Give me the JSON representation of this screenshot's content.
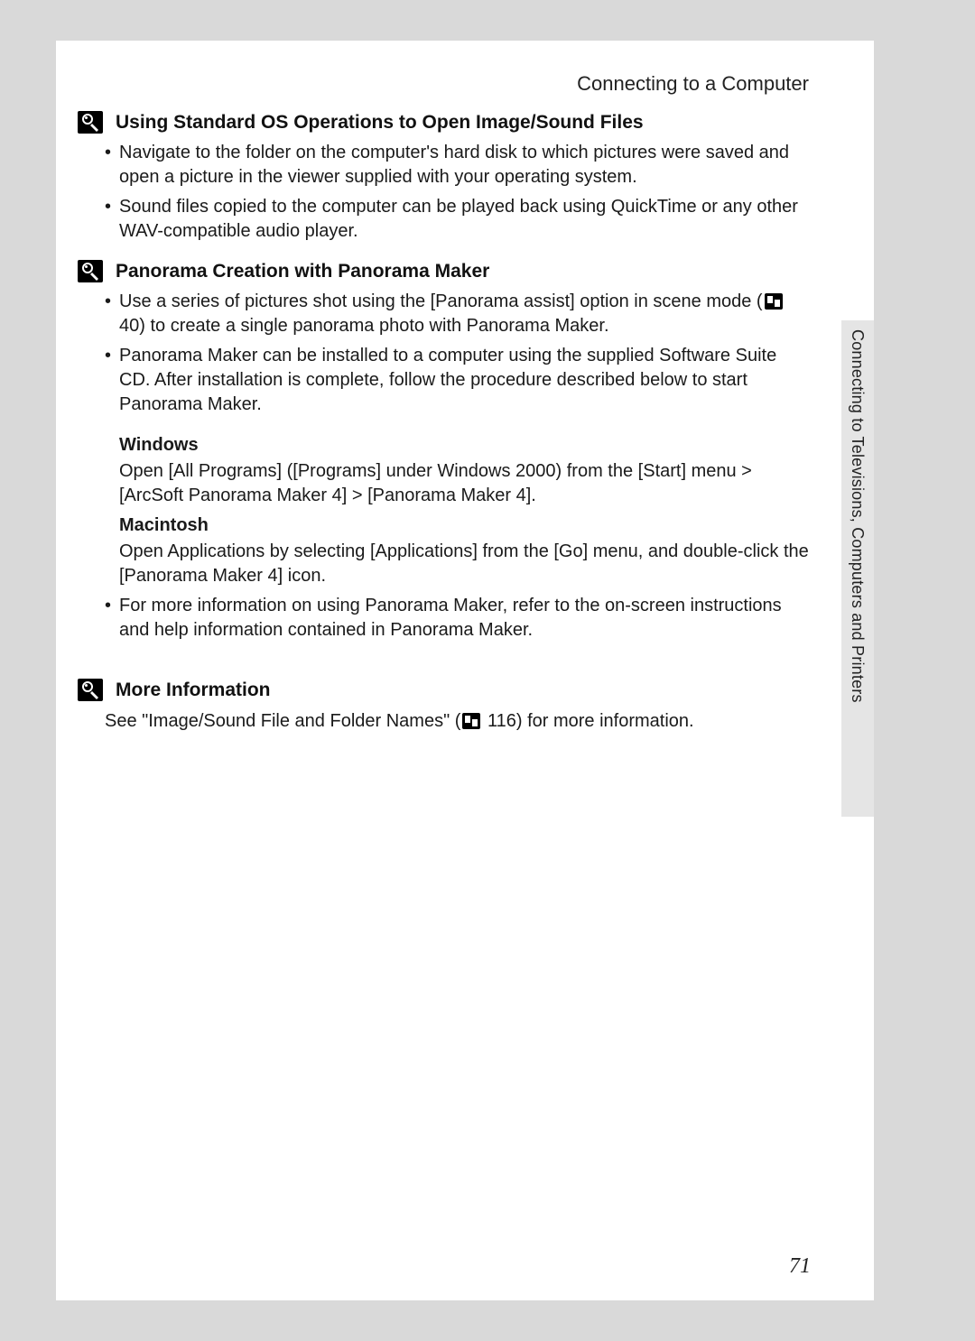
{
  "header": {
    "title": "Connecting to a Computer"
  },
  "sections": {
    "s1": {
      "title": "Using Standard OS Operations to Open Image/Sound Files",
      "b1": "Navigate to the folder on the computer's hard disk to which pictures were saved and open a picture in the viewer supplied with your operating system.",
      "b2": "Sound files copied to the computer can be played back using QuickTime or any other WAV-compatible audio player."
    },
    "s2": {
      "title": "Panorama Creation with Panorama Maker",
      "b1a": "Use a series of pictures shot using the [Panorama assist] option in scene mode (",
      "b1_ref": "40",
      "b1b": ") to create a single panorama photo with Panorama Maker.",
      "b2": "Panorama Maker can be installed to a computer using the supplied Software Suite CD. After installation is complete, follow the procedure described below to start Panorama Maker.",
      "win_label": "Windows",
      "win_body": "Open [All Programs] ([Programs] under Windows 2000) from the [Start] menu > [ArcSoft Panorama Maker 4] > [Panorama Maker 4].",
      "mac_label": "Macintosh",
      "mac_body": "Open Applications by selecting [Applications] from the [Go] menu, and double-click the [Panorama Maker 4] icon.",
      "b3": "For more information on using Panorama Maker, refer to the on-screen instructions and help information contained in Panorama Maker."
    },
    "s3": {
      "title": "More Information",
      "p1a": "See \"Image/Sound File and Folder Names\" (",
      "p1_ref": "116",
      "p1b": ") for more information."
    }
  },
  "side_tab": "Connecting to Televisions, Computers and Printers",
  "page_number": "71"
}
